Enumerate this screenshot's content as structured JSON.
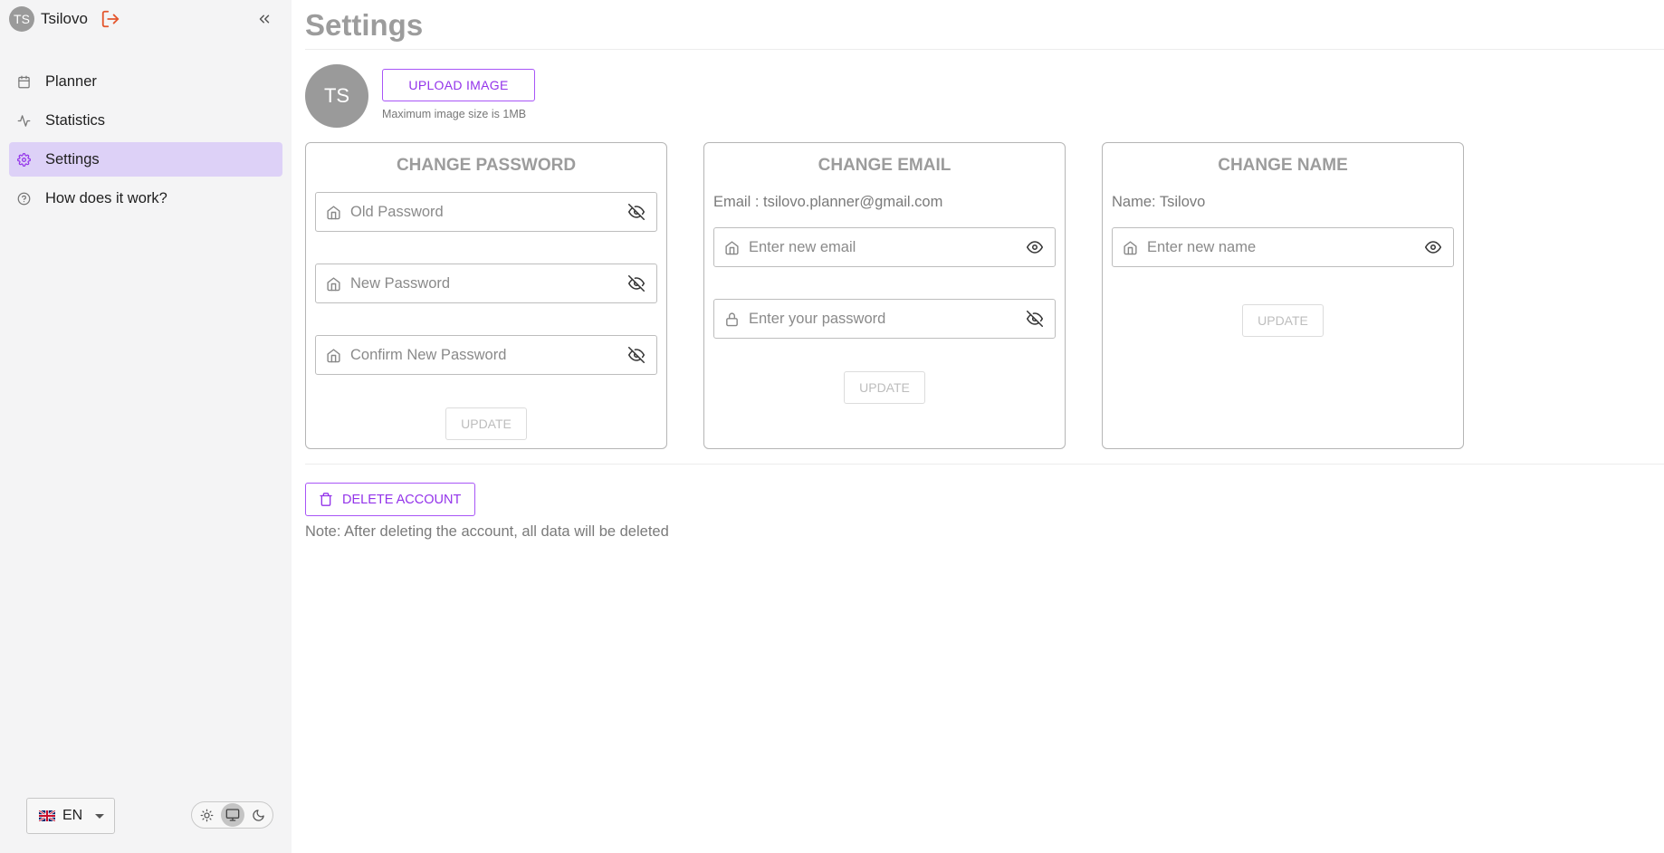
{
  "sidebar": {
    "user": {
      "initials": "TS",
      "name": "Tsilovo"
    },
    "nav": [
      {
        "label": "Planner",
        "icon": "calendar-icon"
      },
      {
        "label": "Statistics",
        "icon": "activity-icon"
      },
      {
        "label": "Settings",
        "icon": "gear-icon",
        "active": true
      },
      {
        "label": "How does it work?",
        "icon": "help-circle-icon"
      }
    ],
    "language": {
      "code": "EN",
      "flag": "uk-flag-icon"
    },
    "theme": {
      "selected": "system",
      "options": [
        "light",
        "system",
        "dark"
      ]
    }
  },
  "page": {
    "title": "Settings"
  },
  "profile": {
    "initials": "TS",
    "upload_label": "UPLOAD IMAGE",
    "upload_note": "Maximum image size is 1MB"
  },
  "password_card": {
    "title": "CHANGE PASSWORD",
    "old_placeholder": "Old Password",
    "new_placeholder": "New Password",
    "confirm_placeholder": "Confirm New Password",
    "update_label": "UPDATE"
  },
  "email_card": {
    "title": "CHANGE EMAIL",
    "current": "Email : tsilovo.planner@gmail.com",
    "email_placeholder": "Enter new email",
    "password_placeholder": "Enter your password",
    "update_label": "UPDATE"
  },
  "name_card": {
    "title": "CHANGE NAME",
    "current": "Name: Tsilovo",
    "name_placeholder": "Enter new name",
    "update_label": "UPDATE"
  },
  "danger": {
    "delete_label": "DELETE ACCOUNT",
    "note": "Note: After deleting the account, all data will be deleted"
  },
  "colors": {
    "accent": "#9333ea",
    "active_nav": "#ddd1f7",
    "logout": "#e4572e"
  }
}
